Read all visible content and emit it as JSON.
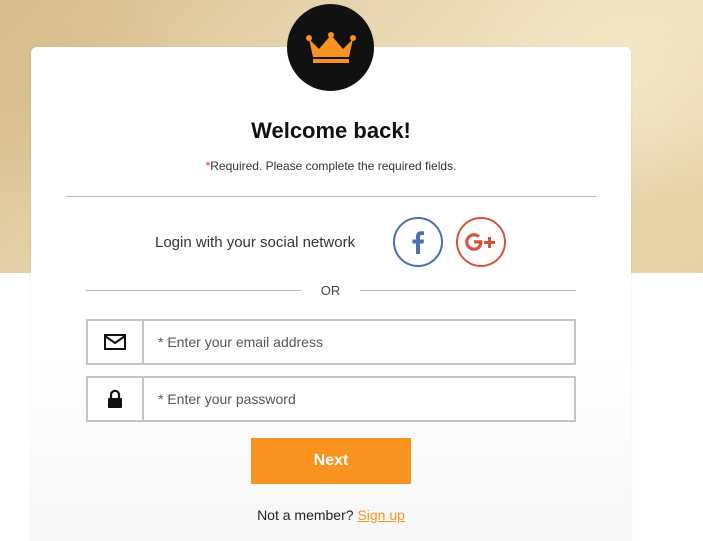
{
  "colors": {
    "accent": "#f7931e",
    "facebook": "#4a6fb5",
    "google": "#d9513e",
    "required_star": "#e03030",
    "logo_bg": "#111111"
  },
  "logo": {
    "icon": "crown-icon"
  },
  "heading": {
    "title": "Welcome back!",
    "required_star": "*",
    "required_text": "Required. Please complete the required fields."
  },
  "social": {
    "label": "Login with your social network",
    "facebook_icon": "facebook-icon",
    "google_icon": "google-plus-icon"
  },
  "divider": {
    "or_text": "OR"
  },
  "form": {
    "email": {
      "icon": "envelope-icon",
      "placeholder": "* Enter your email address",
      "value": ""
    },
    "password": {
      "icon": "lock-icon",
      "placeholder": "* Enter your password",
      "value": ""
    },
    "next_label": "Next"
  },
  "footer": {
    "not_member_text": "Not a member?",
    "signup_label": "Sign up"
  }
}
